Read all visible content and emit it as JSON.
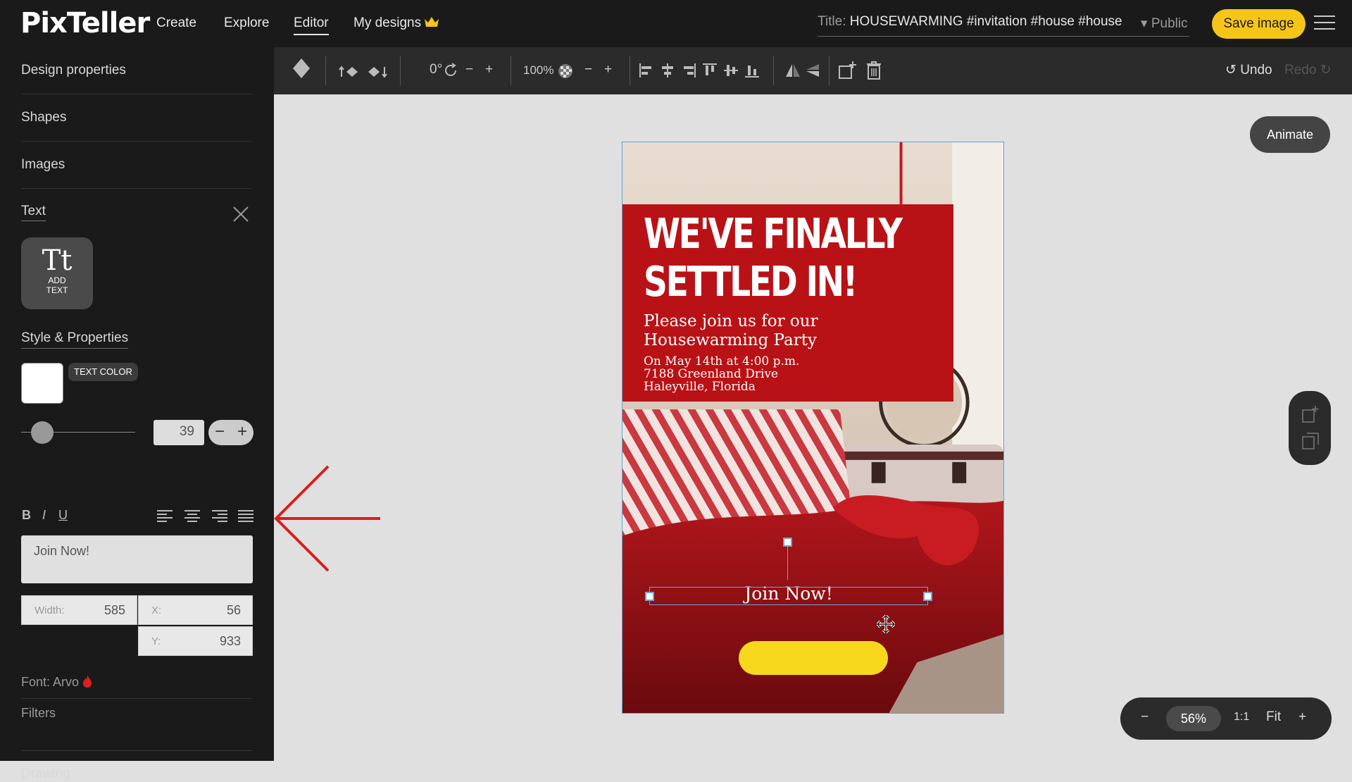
{
  "app": {
    "logo": "PixTeller",
    "nav": [
      "Create",
      "Explore",
      "Editor",
      "My designs"
    ],
    "title_label": "Title:",
    "title_value": "HOUSEWARMING #invitation #house #house",
    "visibility": "Public",
    "save_label": "Save image"
  },
  "sidebar": {
    "sections": [
      "Design properties",
      "Shapes",
      "Images",
      "Text"
    ],
    "add_text_label_1": "ADD",
    "add_text_label_2": "TEXT",
    "style_heading": "Style & Properties",
    "text_color_label": "TEXT COLOR",
    "text_color": "#ffffff",
    "font_size": "39",
    "bold": "B",
    "italic": "I",
    "underline": "U",
    "text_content": "Join Now!",
    "width_label": "Width:",
    "width_value": "585",
    "x_label": "X:",
    "x_value": "56",
    "y_label": "Y:",
    "y_value": "933",
    "font_label": "Font: Arvo",
    "filters_label": "Filters",
    "drawing_label": "Drawing"
  },
  "toolbar": {
    "rotation": "0°",
    "opacity": "100%",
    "undo": "Undo",
    "redo": "Redo"
  },
  "design": {
    "headline_line1": "WE'VE FINALLY",
    "headline_line2": "SETTLED IN!",
    "subhead_line1": "Please join us for our",
    "subhead_line2": "Housewarming Party",
    "detail_line1": "On May 14th at 4:00 p.m.",
    "detail_line2": "7188 Greenland Drive",
    "detail_line3": "Haleyville, Florida",
    "selected_text": "Join Now!",
    "accent_red": "#b91216",
    "button_yellow": "#f7d81c"
  },
  "right": {
    "animate_label": "Animate",
    "zoom_value": "56%",
    "ratio_label": "1:1",
    "fit_label": "Fit"
  }
}
